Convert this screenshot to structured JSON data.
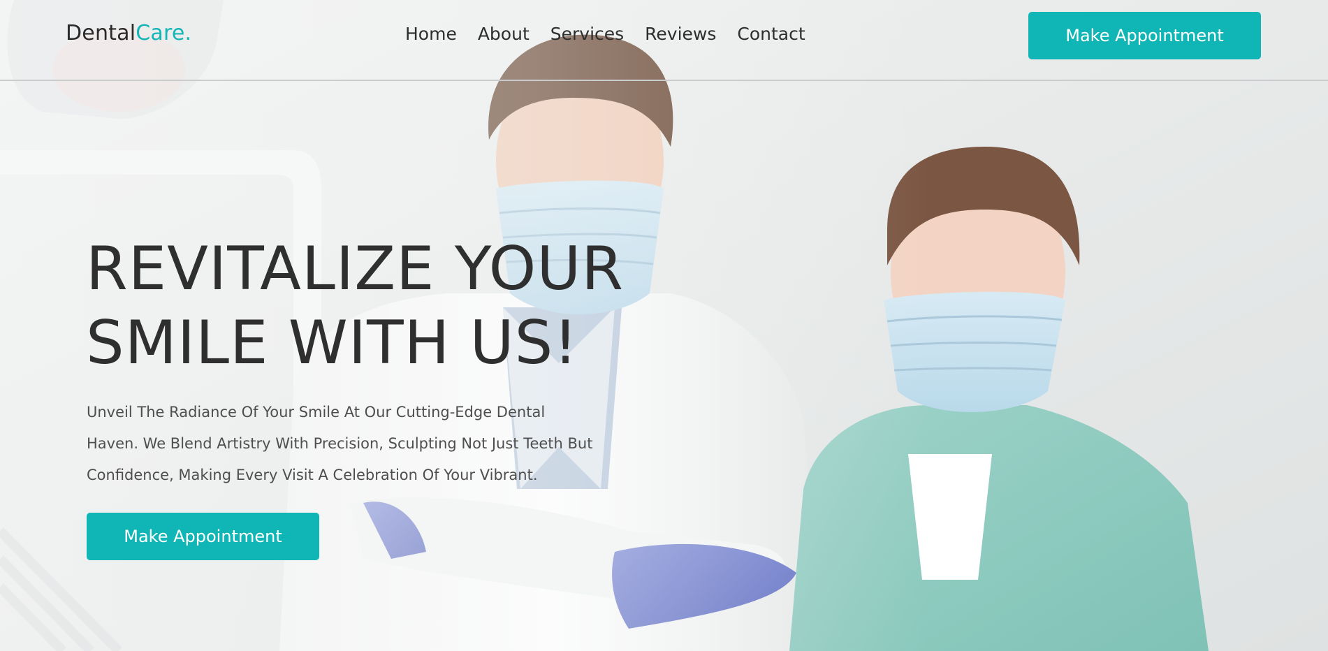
{
  "brand": {
    "name_primary": "Dental",
    "name_accent": "Care.",
    "accent_color": "#13b5b5"
  },
  "nav": {
    "items": [
      {
        "label": "Home"
      },
      {
        "label": "About"
      },
      {
        "label": "Services"
      },
      {
        "label": "Reviews"
      },
      {
        "label": "Contact"
      }
    ]
  },
  "header": {
    "cta_label": "Make Appointment"
  },
  "hero": {
    "title_line1": "REVITALIZE YOUR",
    "title_line2": "SMILE WITH US!",
    "text_line1": "Unveil The Radiance Of Your Smile At Our Cutting-Edge Dental",
    "text_line2": "Haven. We Blend Artistry With Precision, Sculpting Not Just Teeth But",
    "text_line3": "Confidence, Making Every Visit A Celebration Of Your Vibrant.",
    "cta_label": "Make Appointment",
    "image": "dentists-photo"
  },
  "colors": {
    "button_bg": "#10b5b5",
    "button_text": "#ffffff",
    "heading": "#2f2f2f",
    "body_text": "#4e4e4e"
  }
}
